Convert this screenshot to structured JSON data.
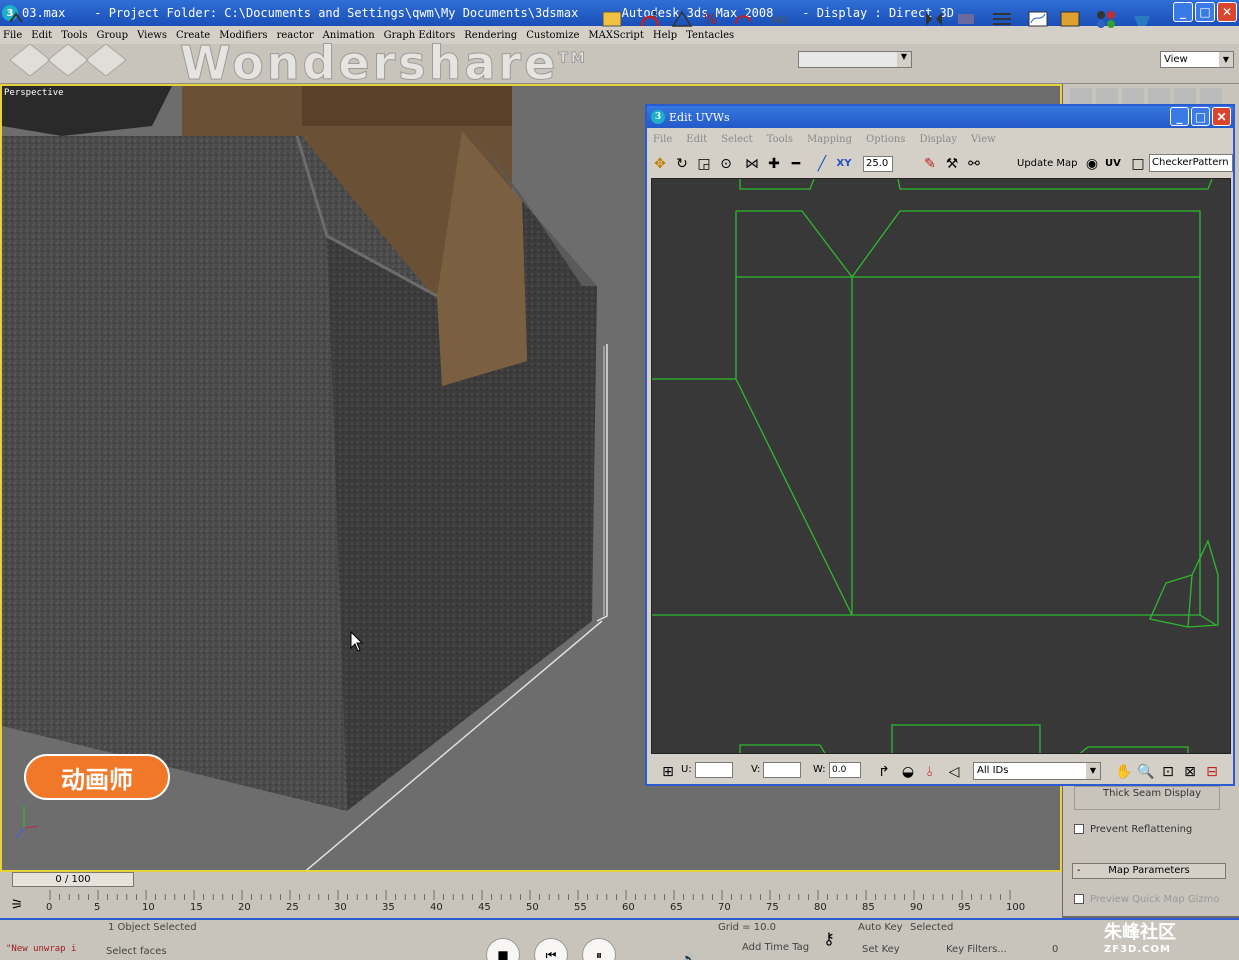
{
  "window": {
    "title": "03.max    - Project Folder: C:\\Documents and Settings\\qwm\\My Documents\\3dsmax    - Autodesk 3ds Max 2008    - Display : Direct 3D",
    "min": "_",
    "max": "□",
    "close": "✕"
  },
  "menu": [
    "File",
    "Edit",
    "Tools",
    "Group",
    "Views",
    "Create",
    "Modifiers",
    "reactor",
    "Animation",
    "Graph Editors",
    "Rendering",
    "Customize",
    "MAXScript",
    "Help",
    "Tentacles"
  ],
  "toolbar": {
    "view_dropdown": "View"
  },
  "watermark": {
    "text": "Wondershare",
    "tm": "TM"
  },
  "viewport": {
    "label": "Perspective"
  },
  "badge": {
    "text": "动画师"
  },
  "uvw": {
    "title": "Edit UVWs",
    "menu": [
      "File",
      "Edit",
      "Select",
      "Tools",
      "Mapping",
      "Options",
      "Display",
      "View"
    ],
    "zoom": "25.0",
    "update_map": "Update Map",
    "uv": "UV",
    "pattern": "CheckerPattern",
    "u_label": "U:",
    "v_label": "V:",
    "w_label": "W:",
    "w_value": "0.0",
    "ids": "All IDs"
  },
  "cmdpanel": {
    "thick_seam": "Thick Seam Display",
    "prevent_reflatten": "Prevent Reflattening",
    "map_params": "Map Parameters",
    "preview_gizmo": "Preview Quick Map Gizmo"
  },
  "timeline": {
    "position": "0 / 100",
    "ticks": [
      "0",
      "5",
      "10",
      "15",
      "20",
      "25",
      "30",
      "35",
      "40",
      "45",
      "50",
      "55",
      "60",
      "65",
      "70",
      "75",
      "80",
      "85",
      "90",
      "95",
      "100"
    ]
  },
  "status": {
    "selected": "1 Object Selected",
    "prompt": "Select faces",
    "script": "\"New unwrap i",
    "grid": "Grid = 10.0",
    "autokey": "Auto Key",
    "selected_dd": "Selected",
    "setkey": "Set Key",
    "keyfilters": "Key Filters...",
    "frame": "0",
    "add_time_tag": "Add Time Tag"
  },
  "site_logo": {
    "name": "朱峰社区",
    "url": "ZF3D.COM"
  },
  "colors": {
    "uv_edge": "#2fb82f",
    "viewport_border": "#e5d23c",
    "title_blue": "#1a4fb8",
    "badge": "#f07828"
  }
}
